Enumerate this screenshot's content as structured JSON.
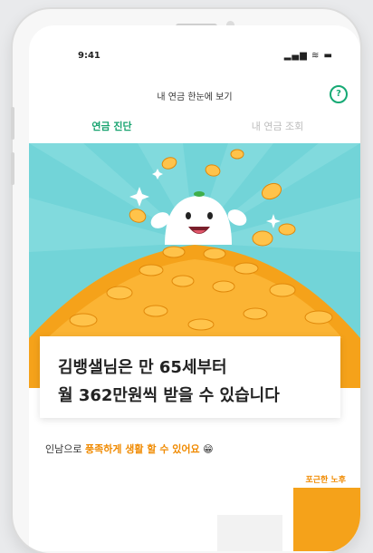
{
  "status_bar": {
    "time": "9:41",
    "icons": "▂▄▆ ≋ ▬"
  },
  "header": {
    "title": "내 연금 한눈에 보기",
    "help_icon": "question-circle-icon",
    "help_symbol": "?"
  },
  "tabs": [
    {
      "label": "연금 진단",
      "active": true
    },
    {
      "label": "내 연금 조회",
      "active": false
    }
  ],
  "hero": {
    "illustration": "mascot-on-gold-coins",
    "colors": {
      "sky": "#72d4d8",
      "coin": "#f5a21a",
      "coin_light": "#ffc34a"
    }
  },
  "result": {
    "line1": "김뱅샐님은 만 65세부터",
    "line2": "월 362만원씩 받을 수 있습니다"
  },
  "description": {
    "prefix": "인남으로 ",
    "highlight": "풍족하게 생활 할 수 있어요",
    "emoji": "😁"
  },
  "comparison": {
    "bar_label": "포근한 노후",
    "colors": {
      "highlight": "#f5a21a",
      "neutral": "#f2f2f2"
    }
  },
  "colors": {
    "accent_green": "#19b37d"
  }
}
